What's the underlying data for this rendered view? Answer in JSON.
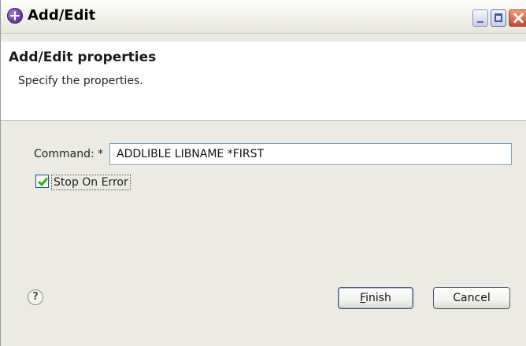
{
  "window": {
    "title": "Add/Edit",
    "controls": [
      "minimize",
      "maximize",
      "close"
    ]
  },
  "banner": {
    "title": "Add/Edit properties",
    "description": "Specify the properties."
  },
  "form": {
    "command_label": "Command: *",
    "command_value": "ADDLIBLE LIBNAME *FIRST",
    "stop_on_error_label": "Stop On Error",
    "stop_on_error_checked": true
  },
  "footer": {
    "help_glyph": "?",
    "finish_mnemonic": "F",
    "finish_rest": "inish",
    "cancel_label": "Cancel"
  },
  "icons": {
    "app": "app-icon",
    "help": "help-icon"
  }
}
